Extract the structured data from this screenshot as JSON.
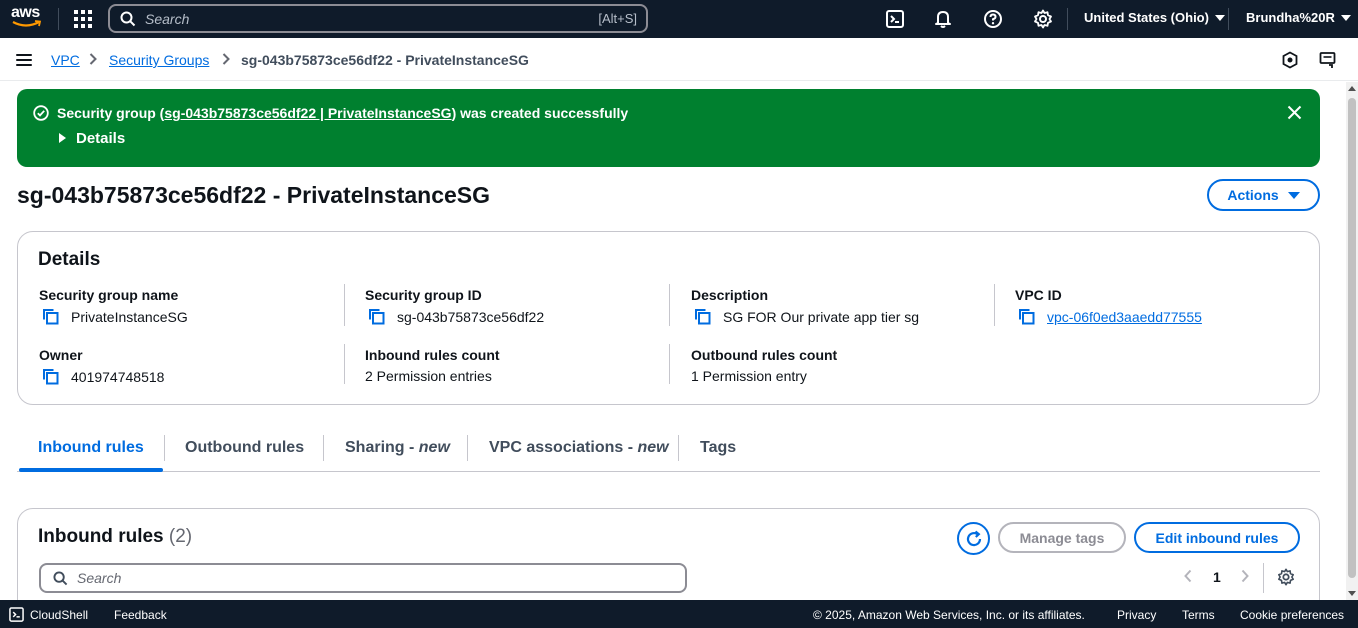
{
  "topnav": {
    "logo_text": "aws",
    "search_placeholder": "Search",
    "search_shortcut": "[Alt+S]",
    "region": "United States (Ohio)",
    "user": "Brundha%20R"
  },
  "breadcrumb": {
    "items": [
      "VPC",
      "Security Groups"
    ],
    "current": "sg-043b75873ce56df22 - PrivateInstanceSG"
  },
  "flash": {
    "prefix": "Security group (",
    "link": "sg-043b75873ce56df22 | PrivateInstanceSG",
    "suffix": ") was created successfully",
    "details_label": "Details",
    "color": "#00802f"
  },
  "page": {
    "title": "sg-043b75873ce56df22 - PrivateInstanceSG",
    "actions_label": "Actions"
  },
  "details": {
    "heading": "Details",
    "fields": [
      {
        "label": "Security group name",
        "value": "PrivateInstanceSG"
      },
      {
        "label": "Security group ID",
        "value": "sg-043b75873ce56df22"
      },
      {
        "label": "Description",
        "value": "SG FOR Our private app tier sg"
      },
      {
        "label": "VPC ID",
        "value": "vpc-06f0ed3aaedd77555"
      },
      {
        "label": "Owner",
        "value": "401974748518"
      },
      {
        "label": "Inbound rules count",
        "value": "2 Permission entries"
      },
      {
        "label": "Outbound rules count",
        "value": "1 Permission entry"
      }
    ]
  },
  "tabs": [
    {
      "label": "Inbound rules",
      "suffix": ""
    },
    {
      "label": "Outbound rules",
      "suffix": ""
    },
    {
      "label": "Sharing - ",
      "suffix": "new"
    },
    {
      "label": "VPC associations - ",
      "suffix": "new"
    },
    {
      "label": "Tags",
      "suffix": ""
    }
  ],
  "inbound": {
    "heading": "Inbound rules",
    "count": "(2)",
    "manage_tags_label": "Manage tags",
    "edit_label": "Edit inbound rules",
    "search_placeholder": "Search",
    "page_number": "1"
  },
  "footer": {
    "cloudshell": "CloudShell",
    "feedback": "Feedback",
    "copyright": "© 2025, Amazon Web Services, Inc. or its affiliates.",
    "privacy": "Privacy",
    "terms": "Terms",
    "cookies": "Cookie preferences"
  },
  "colors": {
    "nav_bg": "#0f1b2a",
    "link_blue": "#006ce0",
    "success_green": "#00802f"
  }
}
